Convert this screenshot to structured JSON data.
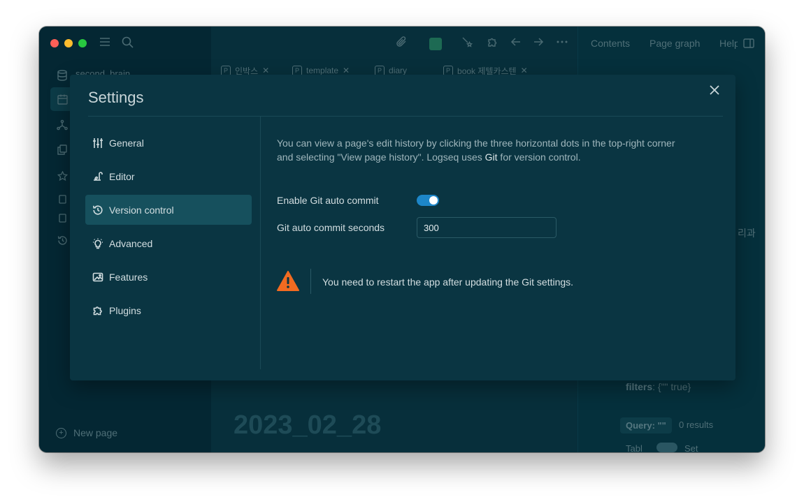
{
  "sidebar": {
    "graph_name": "second_brain",
    "new_page_label": "New page"
  },
  "tabs": [
    {
      "prefix": "P",
      "label": "인박스"
    },
    {
      "prefix": "P",
      "label": "template"
    },
    {
      "prefix": "P",
      "label": "diary"
    },
    {
      "prefix": "P",
      "label": "book  제텔카스텐"
    }
  ],
  "main": {
    "journal_date": "2023_02_28"
  },
  "right_sidebar": {
    "tabs": [
      "Contents",
      "Page graph",
      "Help"
    ],
    "filters_label": "filters",
    "filters_value": ": {\"\" true}",
    "query_label": "Query: \"\"",
    "query_results": "0 results",
    "table_label": "Tabl",
    "set_label": "Set",
    "snippet": "리과 ("
  },
  "settings": {
    "title": "Settings",
    "nav": [
      {
        "label": "General",
        "icon": "sliders-icon"
      },
      {
        "label": "Editor",
        "icon": "writing-icon"
      },
      {
        "label": "Version control",
        "icon": "history-icon",
        "active": true
      },
      {
        "label": "Advanced",
        "icon": "bulb-icon"
      },
      {
        "label": "Features",
        "icon": "image-icon"
      },
      {
        "label": "Plugins",
        "icon": "puzzle-icon"
      }
    ],
    "description_before": "You can view a page's edit history by clicking the three horizontal dots in the top-right corner and selecting \"View page history\". Logseq uses ",
    "description_link": "Git",
    "description_after": " for version control.",
    "git_auto_commit_label": "Enable Git auto commit",
    "git_auto_commit_enabled": true,
    "git_seconds_label": "Git auto commit seconds",
    "git_seconds_value": "300",
    "warning_text": "You need to restart the app after updating the Git settings.",
    "colors": {
      "toggle_on": "#1d86c8",
      "warning": "#f26b21",
      "nav_active": "#16505d"
    }
  }
}
